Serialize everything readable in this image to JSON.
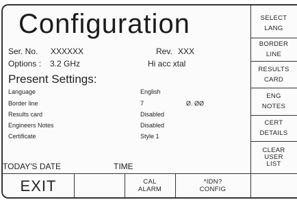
{
  "title": "Configuration",
  "info": {
    "serial_label": "Ser. No.",
    "serial_value": "XXXXXX",
    "rev_label": "Rev.",
    "rev_value": "XXX",
    "options_label": "Options :",
    "options_value": "3.2  GHz",
    "options_extra": "Hi acc  xtal"
  },
  "present_settings": {
    "heading": "Present Settings:",
    "rows": [
      {
        "label": "Language",
        "value": "English",
        "extra": ""
      },
      {
        "label": "Border line",
        "value": "7",
        "extra": "Ø. ØØ"
      },
      {
        "label": "Results card",
        "value": "Disabled",
        "extra": ""
      },
      {
        "label": "Engineers Notes",
        "value": "Disabled",
        "extra": ""
      },
      {
        "label": "Certificate",
        "value": "Style 1",
        "extra": ""
      }
    ]
  },
  "footer": {
    "date_label": "TODAY'S DATE",
    "time_label": "TIME"
  },
  "softkeys": [
    [
      "SELECT",
      "LANG"
    ],
    [
      "BORDER",
      "LINE"
    ],
    [
      "RESULTS",
      "CARD"
    ],
    [
      "ENG",
      "NOTES"
    ],
    [
      "CERT",
      "DETAILS"
    ],
    [
      "CLEAR",
      "USER",
      "LIST"
    ]
  ],
  "bottom_keys": {
    "exit": "EXIT",
    "cal_alarm": [
      "CAL",
      "ALARM"
    ],
    "idn_config": [
      "*IDN?",
      "CONFIG"
    ]
  }
}
